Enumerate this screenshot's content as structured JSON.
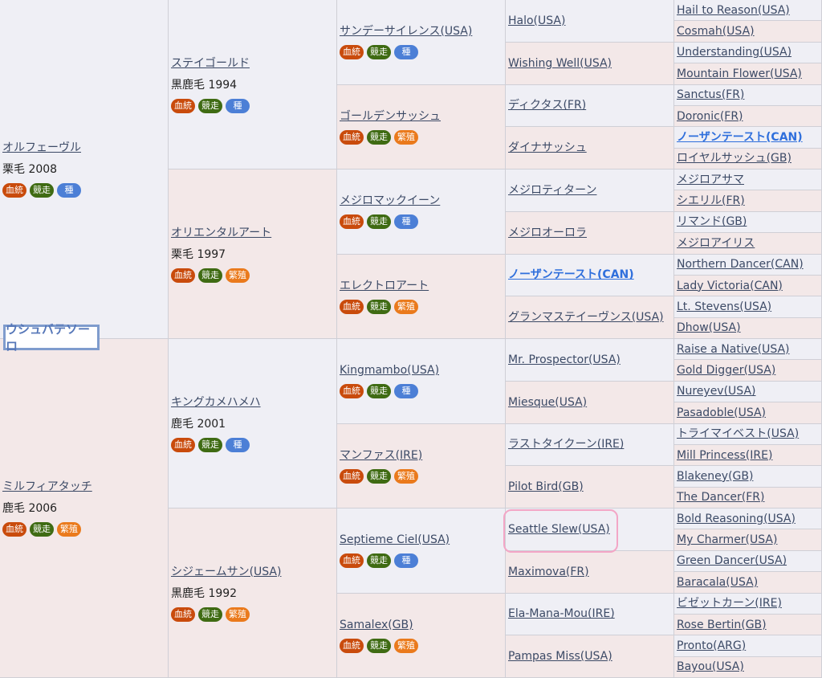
{
  "root_horse": "ウシュバテソーロ",
  "badges": [
    {
      "label": "血統",
      "color": "#c94b0c"
    },
    {
      "label": "競走",
      "color": "#3f6b13"
    },
    {
      "label": "種",
      "color": "#4c7fd6"
    },
    {
      "label": "繁殖",
      "color": "#ea7a1c"
    }
  ],
  "pedigree": [
    {
      "col": 1,
      "row": 1,
      "span": 16,
      "side": "sire",
      "name": "オルフェーヴル",
      "detail": "栗毛 2008",
      "badges": [
        0,
        1,
        2
      ]
    },
    {
      "col": 1,
      "row": 17,
      "span": 16,
      "side": "dam",
      "name": "ミルフィアタッチ",
      "detail": "鹿毛 2006",
      "badges": [
        0,
        1,
        3
      ]
    },
    {
      "col": 2,
      "row": 1,
      "span": 8,
      "side": "sire",
      "name": "ステイゴールド",
      "detail": "黒鹿毛 1994",
      "badges": [
        0,
        1,
        2
      ]
    },
    {
      "col": 2,
      "row": 9,
      "span": 8,
      "side": "dam",
      "name": "オリエンタルアート",
      "detail": "栗毛 1997",
      "badges": [
        0,
        1,
        3
      ]
    },
    {
      "col": 2,
      "row": 17,
      "span": 8,
      "side": "sire",
      "name": "キングカメハメハ",
      "detail": "鹿毛 2001",
      "badges": [
        0,
        1,
        2
      ]
    },
    {
      "col": 2,
      "row": 25,
      "span": 8,
      "side": "dam",
      "name": "シジェームサン(USA)",
      "detail": "黒鹿毛 1992",
      "badges": [
        0,
        1,
        3
      ]
    },
    {
      "col": 3,
      "row": 1,
      "span": 4,
      "side": "sire",
      "name": "サンデーサイレンス(USA)",
      "badges": [
        0,
        1,
        2
      ]
    },
    {
      "col": 3,
      "row": 5,
      "span": 4,
      "side": "dam",
      "name": "ゴールデンサッシュ",
      "badges": [
        0,
        1,
        3
      ]
    },
    {
      "col": 3,
      "row": 9,
      "span": 4,
      "side": "sire",
      "name": "メジロマックイーン",
      "badges": [
        0,
        1,
        2
      ]
    },
    {
      "col": 3,
      "row": 13,
      "span": 4,
      "side": "dam",
      "name": "エレクトロアート",
      "badges": [
        0,
        1,
        3
      ]
    },
    {
      "col": 3,
      "row": 17,
      "span": 4,
      "side": "sire",
      "name": "Kingmambo(USA)",
      "badges": [
        0,
        1,
        2
      ]
    },
    {
      "col": 3,
      "row": 21,
      "span": 4,
      "side": "dam",
      "name": "マンファス(IRE)",
      "badges": [
        0,
        1,
        3
      ]
    },
    {
      "col": 3,
      "row": 25,
      "span": 4,
      "side": "sire",
      "name": "Septieme Ciel(USA)",
      "badges": [
        0,
        1,
        2
      ]
    },
    {
      "col": 3,
      "row": 29,
      "span": 4,
      "side": "dam",
      "name": "Samalex(GB)",
      "badges": [
        0,
        1,
        3
      ]
    },
    {
      "col": 4,
      "row": 1,
      "span": 2,
      "side": "sire",
      "name": "Halo(USA)"
    },
    {
      "col": 4,
      "row": 3,
      "span": 2,
      "side": "dam",
      "name": "Wishing Well(USA)"
    },
    {
      "col": 4,
      "row": 5,
      "span": 2,
      "side": "sire",
      "name": "ディクタス(FR)"
    },
    {
      "col": 4,
      "row": 7,
      "span": 2,
      "side": "dam",
      "name": "ダイナサッシュ"
    },
    {
      "col": 4,
      "row": 9,
      "span": 2,
      "side": "sire",
      "name": "メジロティターン"
    },
    {
      "col": 4,
      "row": 11,
      "span": 2,
      "side": "dam",
      "name": "メジロオーロラ"
    },
    {
      "col": 4,
      "row": 13,
      "span": 2,
      "side": "sire",
      "name": "ノーザンテースト(CAN)",
      "bold": true
    },
    {
      "col": 4,
      "row": 15,
      "span": 2,
      "side": "dam",
      "name": "グランマステイーヴンス(USA)"
    },
    {
      "col": 4,
      "row": 17,
      "span": 2,
      "side": "sire",
      "name": "Mr. Prospector(USA)"
    },
    {
      "col": 4,
      "row": 19,
      "span": 2,
      "side": "dam",
      "name": "Miesque(USA)"
    },
    {
      "col": 4,
      "row": 21,
      "span": 2,
      "side": "sire",
      "name": "ラストタイクーン(IRE)"
    },
    {
      "col": 4,
      "row": 23,
      "span": 2,
      "side": "dam",
      "name": "Pilot Bird(GB)"
    },
    {
      "col": 4,
      "row": 25,
      "span": 2,
      "side": "sire",
      "name": "Seattle Slew(USA)"
    },
    {
      "col": 4,
      "row": 27,
      "span": 2,
      "side": "dam",
      "name": "Maximova(FR)"
    },
    {
      "col": 4,
      "row": 29,
      "span": 2,
      "side": "sire",
      "name": "Ela-Mana-Mou(IRE)"
    },
    {
      "col": 4,
      "row": 31,
      "span": 2,
      "side": "dam",
      "name": "Pampas Miss(USA)"
    },
    {
      "col": 5,
      "row": 1,
      "span": 1,
      "side": "sire",
      "name": "Hail to Reason(USA)"
    },
    {
      "col": 5,
      "row": 2,
      "span": 1,
      "side": "dam",
      "name": "Cosmah(USA)"
    },
    {
      "col": 5,
      "row": 3,
      "span": 1,
      "side": "sire",
      "name": "Understanding(USA)"
    },
    {
      "col": 5,
      "row": 4,
      "span": 1,
      "side": "dam",
      "name": "Mountain Flower(USA)"
    },
    {
      "col": 5,
      "row": 5,
      "span": 1,
      "side": "sire",
      "name": "Sanctus(FR)"
    },
    {
      "col": 5,
      "row": 6,
      "span": 1,
      "side": "dam",
      "name": "Doronic(FR)"
    },
    {
      "col": 5,
      "row": 7,
      "span": 1,
      "side": "sire",
      "name": "ノーザンテースト(CAN)",
      "bold": true
    },
    {
      "col": 5,
      "row": 8,
      "span": 1,
      "side": "dam",
      "name": "ロイヤルサッシュ(GB)"
    },
    {
      "col": 5,
      "row": 9,
      "span": 1,
      "side": "sire",
      "name": "メジロアサマ"
    },
    {
      "col": 5,
      "row": 10,
      "span": 1,
      "side": "dam",
      "name": "シエリル(FR)"
    },
    {
      "col": 5,
      "row": 11,
      "span": 1,
      "side": "sire",
      "name": "リマンド(GB)"
    },
    {
      "col": 5,
      "row": 12,
      "span": 1,
      "side": "dam",
      "name": "メジロアイリス"
    },
    {
      "col": 5,
      "row": 13,
      "span": 1,
      "side": "sire",
      "name": "Northern Dancer(CAN)"
    },
    {
      "col": 5,
      "row": 14,
      "span": 1,
      "side": "dam",
      "name": "Lady Victoria(CAN)"
    },
    {
      "col": 5,
      "row": 15,
      "span": 1,
      "side": "sire",
      "name": "Lt. Stevens(USA)"
    },
    {
      "col": 5,
      "row": 16,
      "span": 1,
      "side": "dam",
      "name": "Dhow(USA)"
    },
    {
      "col": 5,
      "row": 17,
      "span": 1,
      "side": "sire",
      "name": "Raise a Native(USA)"
    },
    {
      "col": 5,
      "row": 18,
      "span": 1,
      "side": "dam",
      "name": "Gold Digger(USA)"
    },
    {
      "col": 5,
      "row": 19,
      "span": 1,
      "side": "sire",
      "name": "Nureyev(USA)"
    },
    {
      "col": 5,
      "row": 20,
      "span": 1,
      "side": "dam",
      "name": "Pasadoble(USA)"
    },
    {
      "col": 5,
      "row": 21,
      "span": 1,
      "side": "sire",
      "name": "トライマイベスト(USA)"
    },
    {
      "col": 5,
      "row": 22,
      "span": 1,
      "side": "dam",
      "name": "Mill Princess(IRE)"
    },
    {
      "col": 5,
      "row": 23,
      "span": 1,
      "side": "sire",
      "name": "Blakeney(GB)"
    },
    {
      "col": 5,
      "row": 24,
      "span": 1,
      "side": "dam",
      "name": "The Dancer(FR)"
    },
    {
      "col": 5,
      "row": 25,
      "span": 1,
      "side": "sire",
      "name": "Bold Reasoning(USA)"
    },
    {
      "col": 5,
      "row": 26,
      "span": 1,
      "side": "dam",
      "name": "My Charmer(USA)"
    },
    {
      "col": 5,
      "row": 27,
      "span": 1,
      "side": "sire",
      "name": "Green Dancer(USA)"
    },
    {
      "col": 5,
      "row": 28,
      "span": 1,
      "side": "dam",
      "name": "Baracala(USA)"
    },
    {
      "col": 5,
      "row": 29,
      "span": 1,
      "side": "sire",
      "name": "ビゼットカーン(IRE)"
    },
    {
      "col": 5,
      "row": 30,
      "span": 1,
      "side": "dam",
      "name": "Rose Bertin(GB)"
    },
    {
      "col": 5,
      "row": 31,
      "span": 1,
      "side": "sire",
      "name": "Pronto(ARG)"
    },
    {
      "col": 5,
      "row": 32,
      "span": 1,
      "side": "dam",
      "name": "Bayou(USA)"
    }
  ]
}
